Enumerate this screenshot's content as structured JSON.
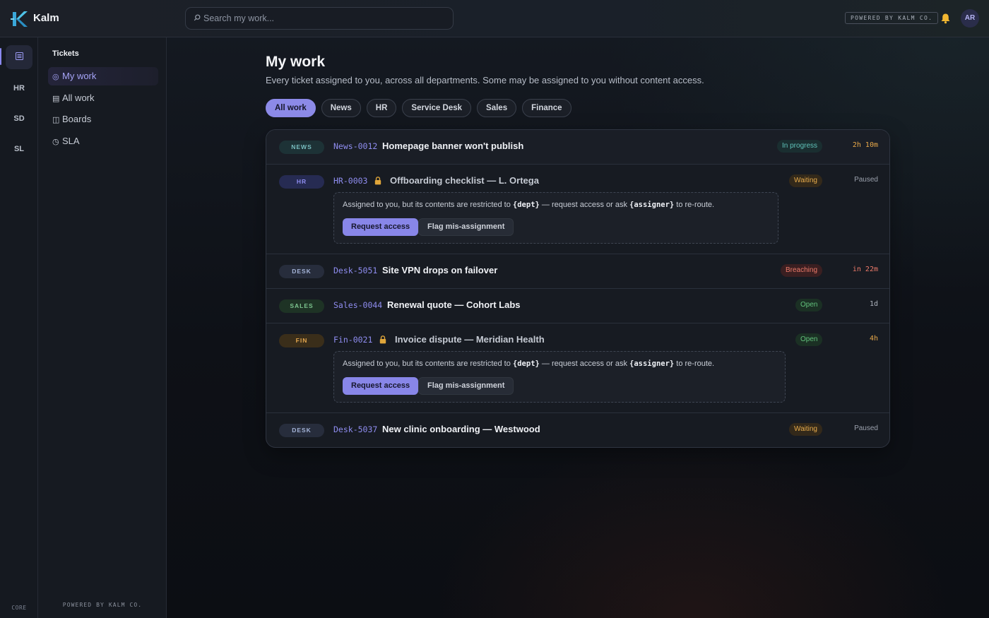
{
  "app": {
    "name": "Kalm",
    "powered_by": "POWERED BY KALM CO.",
    "user_initials": "AR",
    "accent": "#8c8ae8"
  },
  "search": {
    "placeholder": "Search my work..."
  },
  "rail": {
    "items": [
      "HR",
      "SD",
      "SL"
    ],
    "active_icon": "list-icon",
    "footer": "CORE"
  },
  "sidebar": {
    "heading": "Tickets",
    "items": [
      {
        "icon": "◎",
        "label": "My work"
      },
      {
        "icon": "▤",
        "label": "All work"
      },
      {
        "icon": "◫",
        "label": "Boards"
      },
      {
        "icon": "◷",
        "label": "SLA"
      }
    ],
    "footer": "POWERED BY KALM CO."
  },
  "main": {
    "title": "My work",
    "subtitle": "Every ticket assigned to you, across all departments. Some may be assigned to you without content access.",
    "filters": [
      "All work",
      "News",
      "HR",
      "Service Desk",
      "Sales",
      "Finance"
    ]
  },
  "notice": {
    "before": "Assigned to you, but its contents are restricted to ",
    "dept": "{dept}",
    "middle": " — request access or ask ",
    "assigner": "{assigner}",
    "after": " to re-route.",
    "request_label": "Request access",
    "flag_label": "Flag mis-assignment"
  },
  "tickets": [
    {
      "dept": "NEWS",
      "id": "News-0012",
      "title": "Homepage banner won't publish",
      "status": "In progress",
      "time": "2h 10m"
    },
    {
      "dept": "HR",
      "id": "HR-0003",
      "title": "Offboarding checklist — L. Ortega",
      "status": "Waiting",
      "time": "Paused",
      "restricted": true
    },
    {
      "dept": "DESK",
      "id": "Desk-5051",
      "title": "Site VPN drops on failover",
      "status": "Breaching",
      "time": "in 22m"
    },
    {
      "dept": "SALES",
      "id": "Sales-0044",
      "title": "Renewal quote — Cohort Labs",
      "status": "Open",
      "time": "1d"
    },
    {
      "dept": "FIN",
      "id": "Fin-0021",
      "title": "Invoice dispute — Meridian Health",
      "status": "Open",
      "time": "4h",
      "restricted": true
    },
    {
      "dept": "DESK",
      "id": "Desk-5037",
      "title": "New clinic onboarding — Westwood",
      "status": "Waiting",
      "time": "Paused"
    }
  ]
}
